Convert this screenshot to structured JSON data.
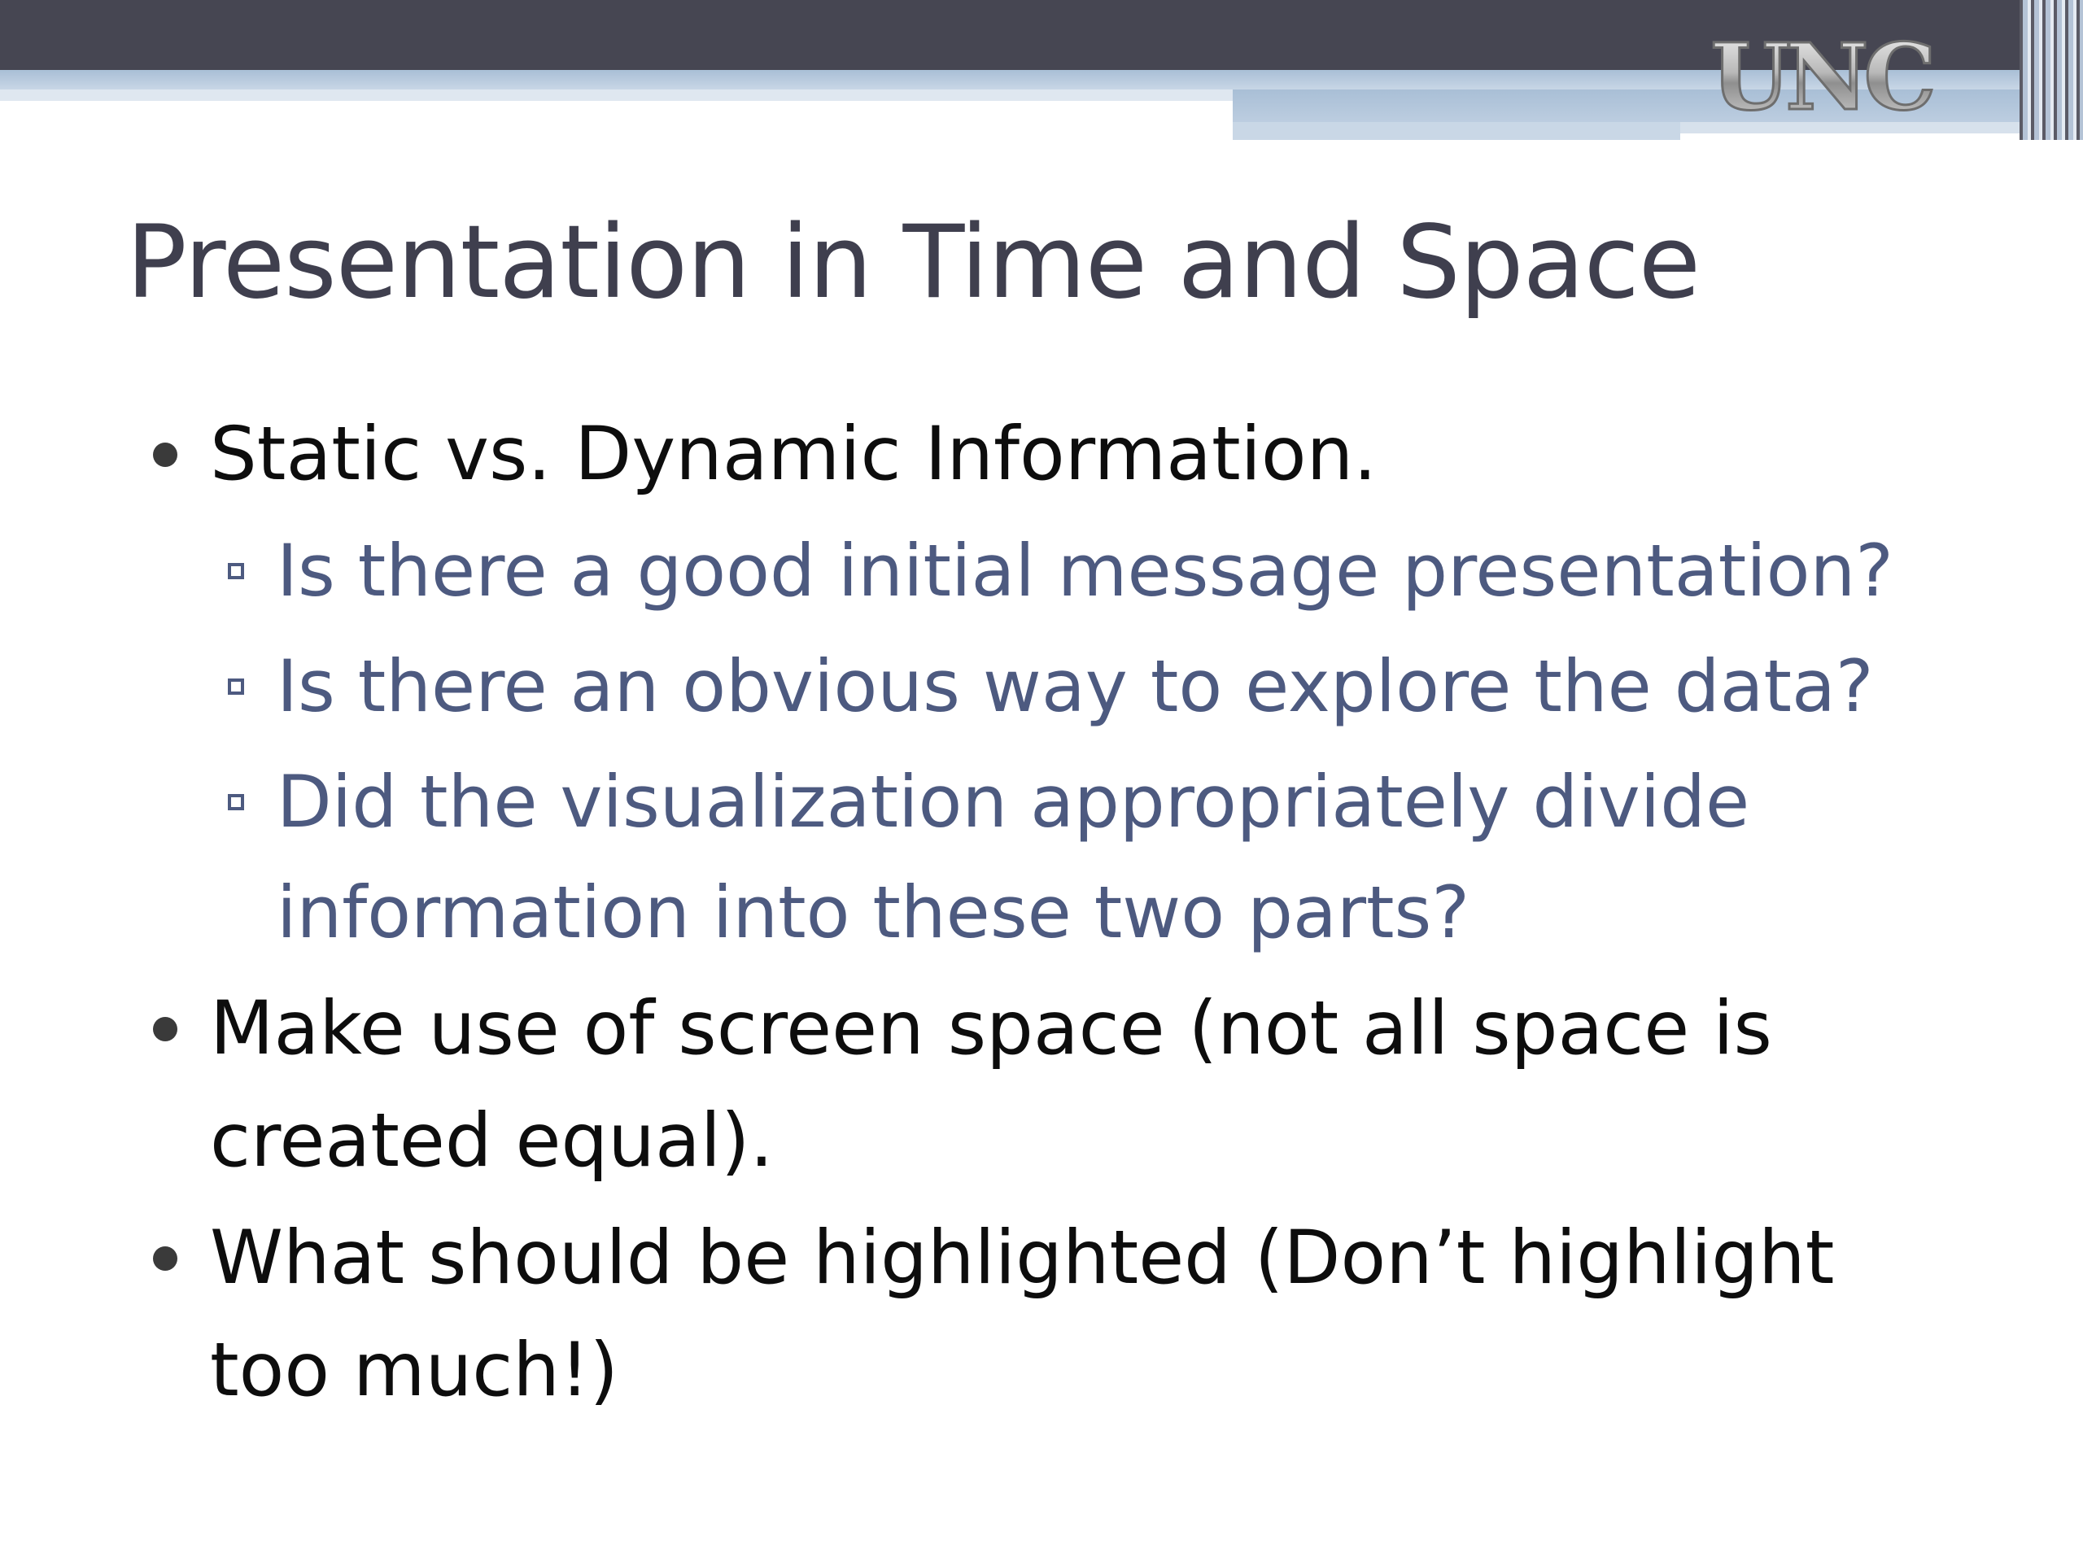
{
  "slide": {
    "logo_text": "UNC",
    "title": "Presentation in Time and Space",
    "bullets": [
      {
        "text": "Static vs. Dynamic Information.",
        "subitems": [
          "Is there a good initial message presentation?",
          "Is there an obvious way to explore the data?",
          "Did the visualization appropriately divide information into these two parts?"
        ]
      },
      {
        "text": "Make use of screen space (not all space is created equal).",
        "subitems": []
      },
      {
        "text": "What should be highlighted (Don’t highlight too much!)",
        "subitems": []
      }
    ]
  },
  "colors": {
    "header_dark": "#464652",
    "header_light": "#a9bfd6",
    "title_text": "#3f3f4e",
    "body_text": "#0d0d0d",
    "sub_text": "#4d5a80"
  }
}
